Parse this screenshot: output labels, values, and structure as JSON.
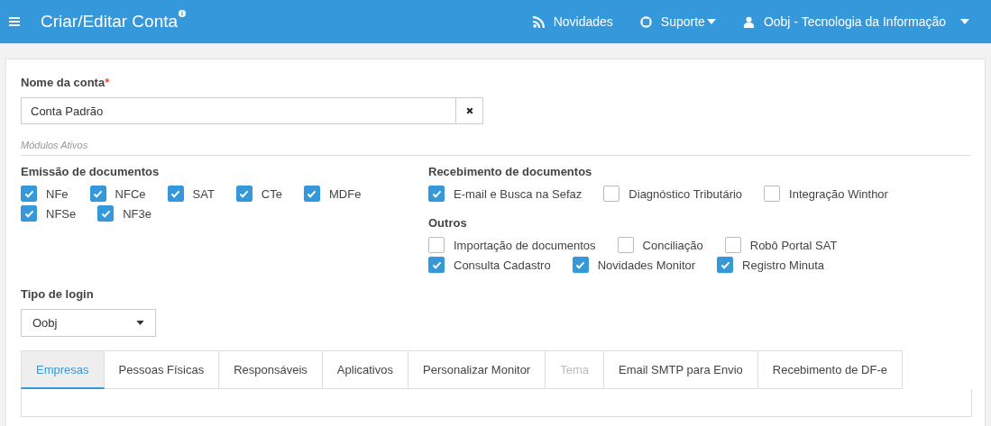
{
  "header": {
    "title": "Criar/Editar Conta",
    "nav": [
      {
        "kind": "feed",
        "label": "Novidades",
        "dropdown": false
      },
      {
        "kind": "support",
        "label": "Suporte",
        "dropdown": true
      },
      {
        "kind": "user",
        "label": "Oobj - Tecnologia da Informação",
        "dropdown": true
      }
    ]
  },
  "account_name": {
    "label": "Nome da conta",
    "required_mark": "*",
    "value": "Conta Padrão"
  },
  "modules_caption": "Módulos Ativos",
  "groups": [
    {
      "title": "Emissão de documentos",
      "rows": [
        [
          {
            "label": "NFe",
            "checked": true
          },
          {
            "label": "NFCe",
            "checked": true
          },
          {
            "label": "SAT",
            "checked": true
          },
          {
            "label": "CTe",
            "checked": true
          },
          {
            "label": "MDFe",
            "checked": true
          }
        ],
        [
          {
            "label": "NFSe",
            "checked": true
          },
          {
            "label": "NF3e",
            "checked": true
          }
        ]
      ]
    },
    {
      "title": "Recebimento de documentos",
      "rows": [
        [
          {
            "label": "E-mail e Busca na Sefaz",
            "checked": true
          },
          {
            "label": "Diagnóstico Tributário",
            "checked": false
          },
          {
            "label": "Integração Winthor",
            "checked": false
          }
        ]
      ]
    },
    {
      "title": "Outros",
      "rows": [
        [
          {
            "label": "Importação de documentos",
            "checked": false
          },
          {
            "label": "Conciliação",
            "checked": false
          },
          {
            "label": "Robô Portal SAT",
            "checked": false
          }
        ],
        [
          {
            "label": "Consulta Cadastro",
            "checked": true
          },
          {
            "label": "Novidades Monitor",
            "checked": true
          },
          {
            "label": "Registro Minuta",
            "checked": true
          }
        ]
      ]
    }
  ],
  "login_type": {
    "label": "Tipo de login",
    "value": "Oobj"
  },
  "tabs": [
    {
      "label": "Empresas",
      "selected": true,
      "disabled": false
    },
    {
      "label": "Pessoas Físicas",
      "selected": false,
      "disabled": false
    },
    {
      "label": "Responsáveis",
      "selected": false,
      "disabled": false
    },
    {
      "label": "Aplicativos",
      "selected": false,
      "disabled": false
    },
    {
      "label": "Personalizar Monitor",
      "selected": false,
      "disabled": false
    },
    {
      "label": "Tema",
      "selected": false,
      "disabled": true
    },
    {
      "label": "Email SMTP para Envio",
      "selected": false,
      "disabled": false
    },
    {
      "label": "Recebimento de DF-e",
      "selected": false,
      "disabled": false
    }
  ]
}
